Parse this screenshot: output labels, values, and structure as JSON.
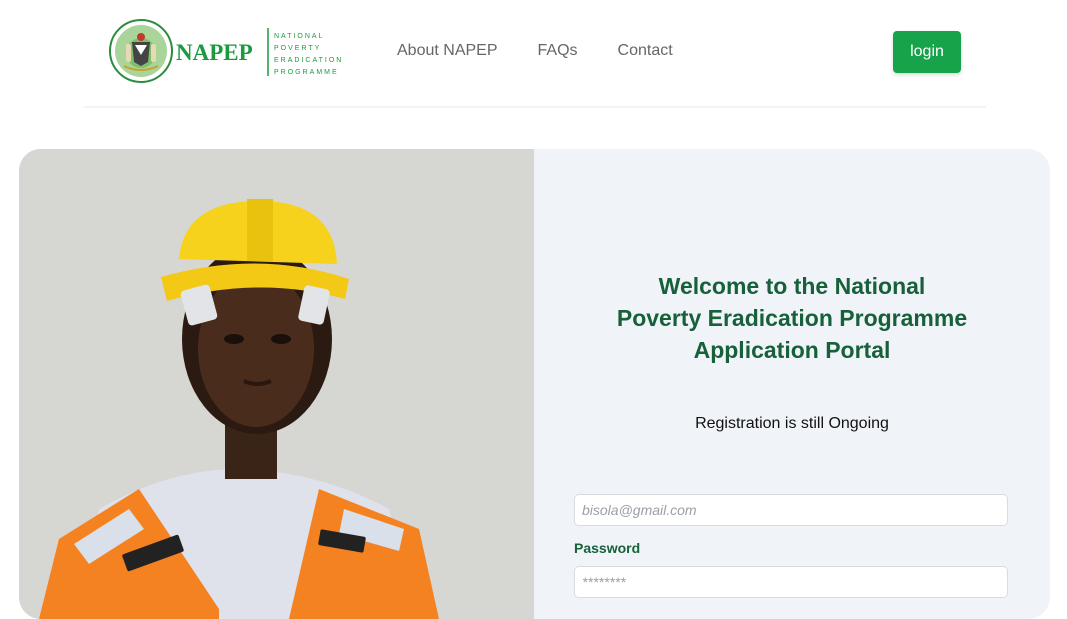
{
  "header": {
    "logo": {
      "brand": "NAPEP",
      "tagline_lines": [
        "NATIONAL",
        "POVERTY",
        "ERADICATION",
        "PROGRAMME"
      ]
    },
    "nav": [
      {
        "label": "About NAPEP"
      },
      {
        "label": "FAQs"
      },
      {
        "label": "Contact"
      }
    ],
    "login_label": "login"
  },
  "hero": {
    "welcome_lines": [
      "Welcome to the National",
      "Poverty Eradication Programme",
      "Application Portal"
    ],
    "registration_note": "Registration is still Ongoing"
  },
  "form": {
    "email_placeholder": "bisola@gmail.com",
    "password_label": "Password",
    "password_placeholder": "********"
  },
  "colors": {
    "brand_green": "#17603a",
    "button_green": "#16a349",
    "panel_bg": "#f0f4f9"
  }
}
